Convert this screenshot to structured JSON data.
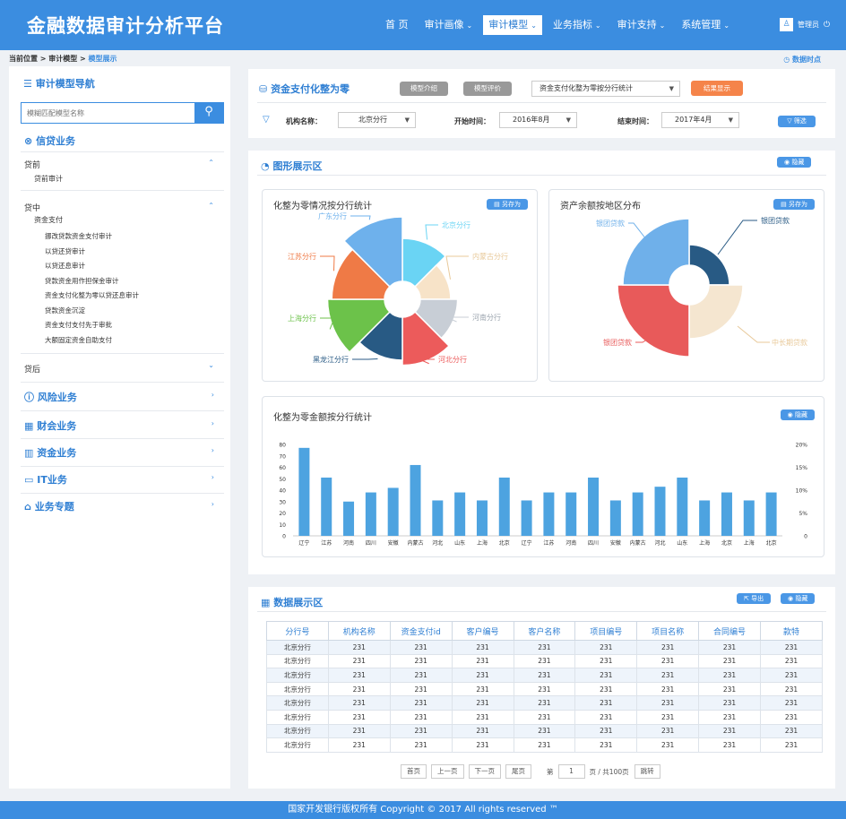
{
  "header": {
    "logo": "金融数据审计分析平台",
    "nav": [
      {
        "label": "首 页",
        "chev": ""
      },
      {
        "label": "审计画像",
        "chev": "⌄"
      },
      {
        "label": "审计模型",
        "chev": "⌄"
      },
      {
        "label": "业务指标",
        "chev": "⌄"
      },
      {
        "label": "审计支持",
        "chev": "⌄"
      },
      {
        "label": "系统管理",
        "chev": "⌄"
      }
    ],
    "active_nav": "审计模型",
    "user": "管理员"
  },
  "breadcrumb": {
    "prefix": "当前位置 > 审计模型 > ",
    "current": "模型展示"
  },
  "data_time": "数据时点",
  "sidebar": {
    "title": "审计模型导航",
    "search_placeholder": "模糊匹配模型名称",
    "credit": "信贷业务",
    "pre": "贷前",
    "pre_sub": "贷前审计",
    "mid": "贷中",
    "mid_sub": "资金支付",
    "mid_items": [
      "挪改贷款资金支付审计",
      "以贷还贷审计",
      "以贷还息审计",
      "贷款资金用作担保金审计",
      "资金支付化整为零以贷还息审计",
      "贷款资金沉淀",
      "资金支付支付先于审批",
      "大额固定资金自助支付"
    ],
    "post": "贷后",
    "categories": [
      "风险业务",
      "财会业务",
      "资金业务",
      "IT业务",
      "业务专题"
    ]
  },
  "filter": {
    "model_title": "资金支付化整为零",
    "btn_intro": "模型介绍",
    "btn_eval": "模型评价",
    "select_model": "资金支付化整为零按分行统计",
    "btn_result": "结果显示",
    "org_label": "机构名称：",
    "org_value": "北京分行",
    "start_label": "开始时间：",
    "start_value": "2016年8月",
    "end_label": "结束时间：",
    "end_value": "2017年4月",
    "btn_filter": "筛选"
  },
  "graph": {
    "title": "图形展示区",
    "hide": "隐藏",
    "save": "另存为",
    "rose_title": "化整为零情况按分行统计",
    "asset_title": "资产余额按地区分布",
    "bar_title": "化整为零金额按分行统计"
  },
  "chart_data": [
    {
      "type": "pie",
      "title": "化整为零情况按分行统计",
      "categories": [
        "北京分行",
        "内蒙古分行",
        "河南分行",
        "河北分行",
        "黑龙江分行",
        "上海分行",
        "江苏分行",
        "广东分行"
      ],
      "values": [
        4,
        2,
        3,
        5,
        4,
        7,
        6,
        9
      ],
      "colors": [
        "#6ad4f4",
        "#f7e3c8",
        "#c8ced6",
        "#ec5b5b",
        "#285a84",
        "#6cc24a",
        "#ef7a46",
        "#6eb1ec"
      ]
    },
    {
      "type": "pie",
      "title": "资产余额按地区分布",
      "categories": [
        "银团贷款",
        "中长期贷款",
        "银团贷款",
        "银团贷款"
      ],
      "values": [
        6,
        7,
        9,
        8
      ],
      "colors": [
        "#285a84",
        "#f5e6d0",
        "#e85a5a",
        "#6fb0ea"
      ]
    },
    {
      "type": "bar",
      "title": "化整为零金额按分行统计",
      "categories": [
        "辽宁",
        "江苏",
        "河南",
        "四川",
        "安徽",
        "内蒙古",
        "河北",
        "山东",
        "上海",
        "北京",
        "辽宁",
        "江苏",
        "河南",
        "四川",
        "安徽",
        "内蒙古",
        "河北",
        "山东",
        "上海",
        "北京",
        "上海",
        "北京"
      ],
      "values": [
        77,
        51,
        30,
        38,
        42,
        62,
        31,
        38,
        31,
        51,
        31,
        38,
        38,
        51,
        31,
        38,
        43,
        51,
        31,
        38,
        31,
        38
      ],
      "ylim": [
        0,
        80
      ],
      "yticks": [
        0,
        10,
        20,
        30,
        40,
        50,
        60,
        70,
        80
      ],
      "y2ticks": [
        "0",
        "5%",
        "10%",
        "15%",
        "20%"
      ],
      "color": "#4da3e0"
    }
  ],
  "datazone": {
    "title": "数据展示区",
    "export": "导出",
    "hide": "隐藏",
    "columns": [
      "分行号",
      "机构名称",
      "资金支付id",
      "客户编号",
      "客户名称",
      "项目编号",
      "项目名称",
      "合同编号",
      "款特"
    ],
    "rows": [
      [
        "北京分行",
        "231",
        "231",
        "231",
        "231",
        "231",
        "231",
        "231",
        "231"
      ],
      [
        "北京分行",
        "231",
        "231",
        "231",
        "231",
        "231",
        "231",
        "231",
        "231"
      ],
      [
        "北京分行",
        "231",
        "231",
        "231",
        "231",
        "231",
        "231",
        "231",
        "231"
      ],
      [
        "北京分行",
        "231",
        "231",
        "231",
        "231",
        "231",
        "231",
        "231",
        "231"
      ],
      [
        "北京分行",
        "231",
        "231",
        "231",
        "231",
        "231",
        "231",
        "231",
        "231"
      ],
      [
        "北京分行",
        "231",
        "231",
        "231",
        "231",
        "231",
        "231",
        "231",
        "231"
      ],
      [
        "北京分行",
        "231",
        "231",
        "231",
        "231",
        "231",
        "231",
        "231",
        "231"
      ],
      [
        "北京分行",
        "231",
        "231",
        "231",
        "231",
        "231",
        "231",
        "231",
        "231"
      ]
    ]
  },
  "pager": {
    "first": "首页",
    "prev": "上一页",
    "next": "下一页",
    "last": "尾页",
    "page_prefix": "第",
    "page_value": "1",
    "page_suffix": "页 / 共100页",
    "jump": "跳转"
  },
  "footer": "国家开发银行版权所有 Copyright © 2017 All rights reserved ™"
}
